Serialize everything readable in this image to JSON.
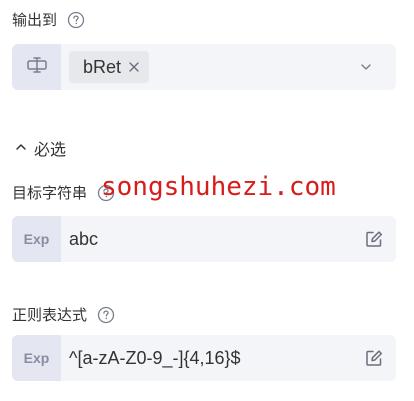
{
  "output": {
    "label": "输出到",
    "tag_value": "bRet"
  },
  "section": {
    "toggle_label": "必选"
  },
  "target_string": {
    "label": "目标字符串",
    "prefix": "Exp",
    "value": "abc"
  },
  "regex": {
    "label": "正则表达式",
    "prefix": "Exp",
    "value": "^[a-zA-Z0-9_-]{4,16}$"
  },
  "watermark": {
    "text": "songshuhezi.com"
  },
  "icons": {
    "help": "question-circle-icon",
    "variable": "variable-icon",
    "close": "close-icon",
    "dropdown": "chevron-down-icon",
    "collapse": "chevron-up-icon",
    "edit": "edit-icon"
  },
  "colors": {
    "field_bg": "#f4f5f8",
    "prefix_bg": "#e4e6f1",
    "tag_bg": "#e7e8ec",
    "watermark": "#d81b1b"
  }
}
